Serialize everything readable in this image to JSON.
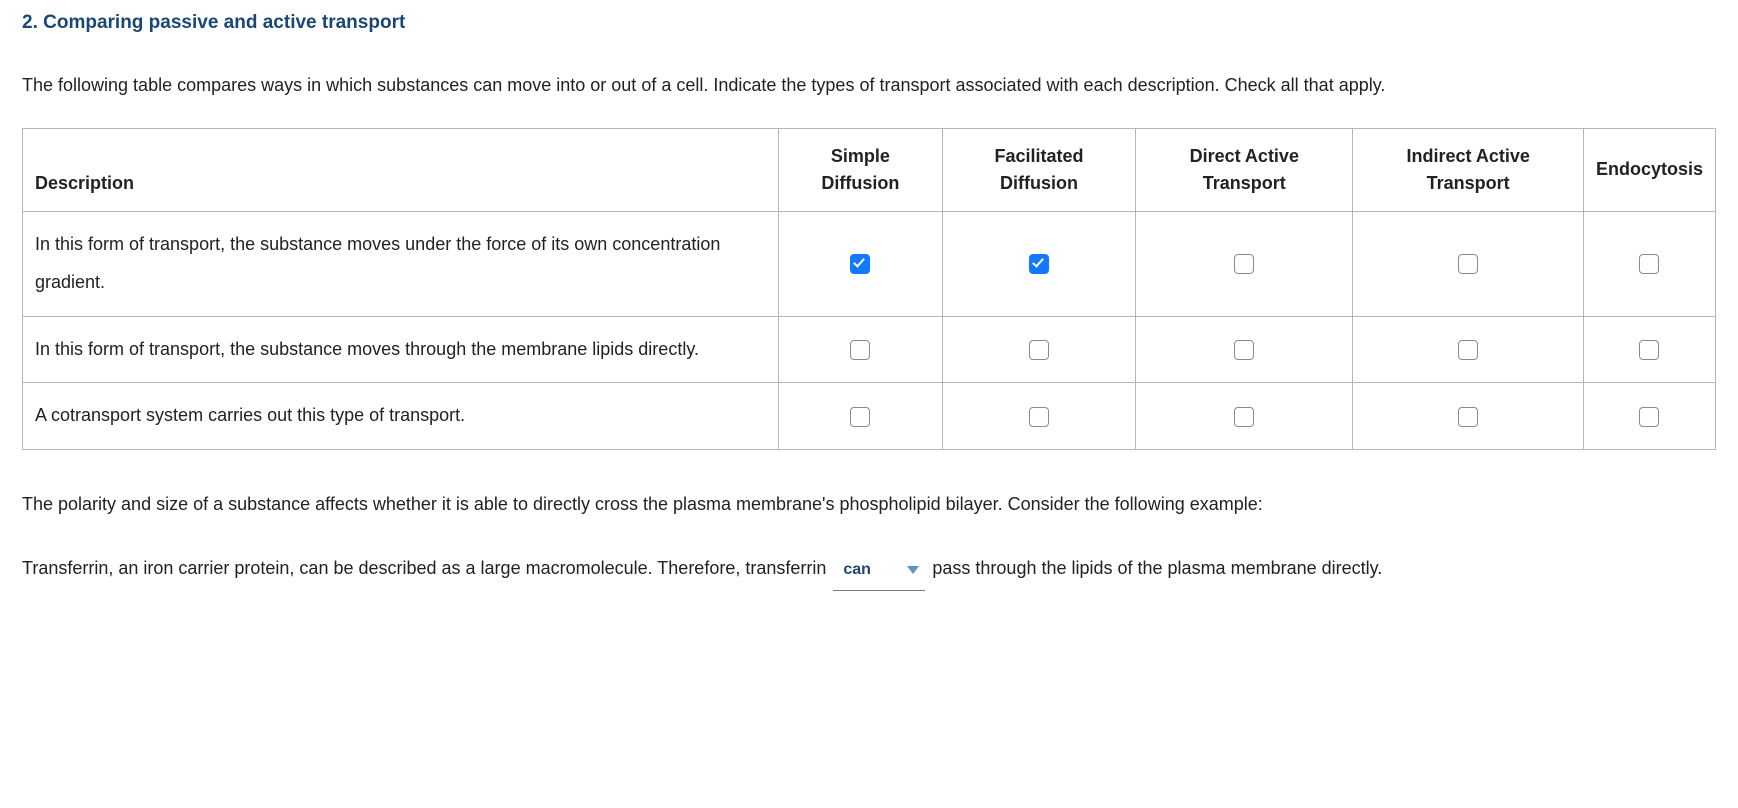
{
  "question": {
    "number_title": "2. Comparing passive and active transport",
    "intro": "The following table compares ways in which substances can move into or out of a cell. Indicate the types of transport associated with each description. Check all that apply."
  },
  "table": {
    "headers": {
      "description": "Description",
      "col1": "Simple Diffusion",
      "col2": "Facilitated Diffusion",
      "col3": "Direct Active Transport",
      "col4": "Indirect Active Transport",
      "col5": "Endocytosis"
    },
    "rows": [
      {
        "desc": "In this form of transport, the substance moves under the force of its own concentration gradient.",
        "checks": [
          true,
          true,
          false,
          false,
          false
        ]
      },
      {
        "desc": "In this form of transport, the substance moves through the membrane lipids directly.",
        "checks": [
          false,
          false,
          false,
          false,
          false
        ]
      },
      {
        "desc": "A cotransport system carries out this type of transport.",
        "checks": [
          false,
          false,
          false,
          false,
          false
        ]
      }
    ]
  },
  "followup": {
    "para": "The polarity and size of a substance affects whether it is able to directly cross the plasma membrane's phospholipid bilayer. Consider the following example:",
    "sentence_pre": "Transferrin, an iron carrier protein, can be described as a large macromolecule. Therefore, transferrin ",
    "dropdown_value": "can",
    "sentence_post": " pass through the lipids of the plasma membrane directly."
  }
}
